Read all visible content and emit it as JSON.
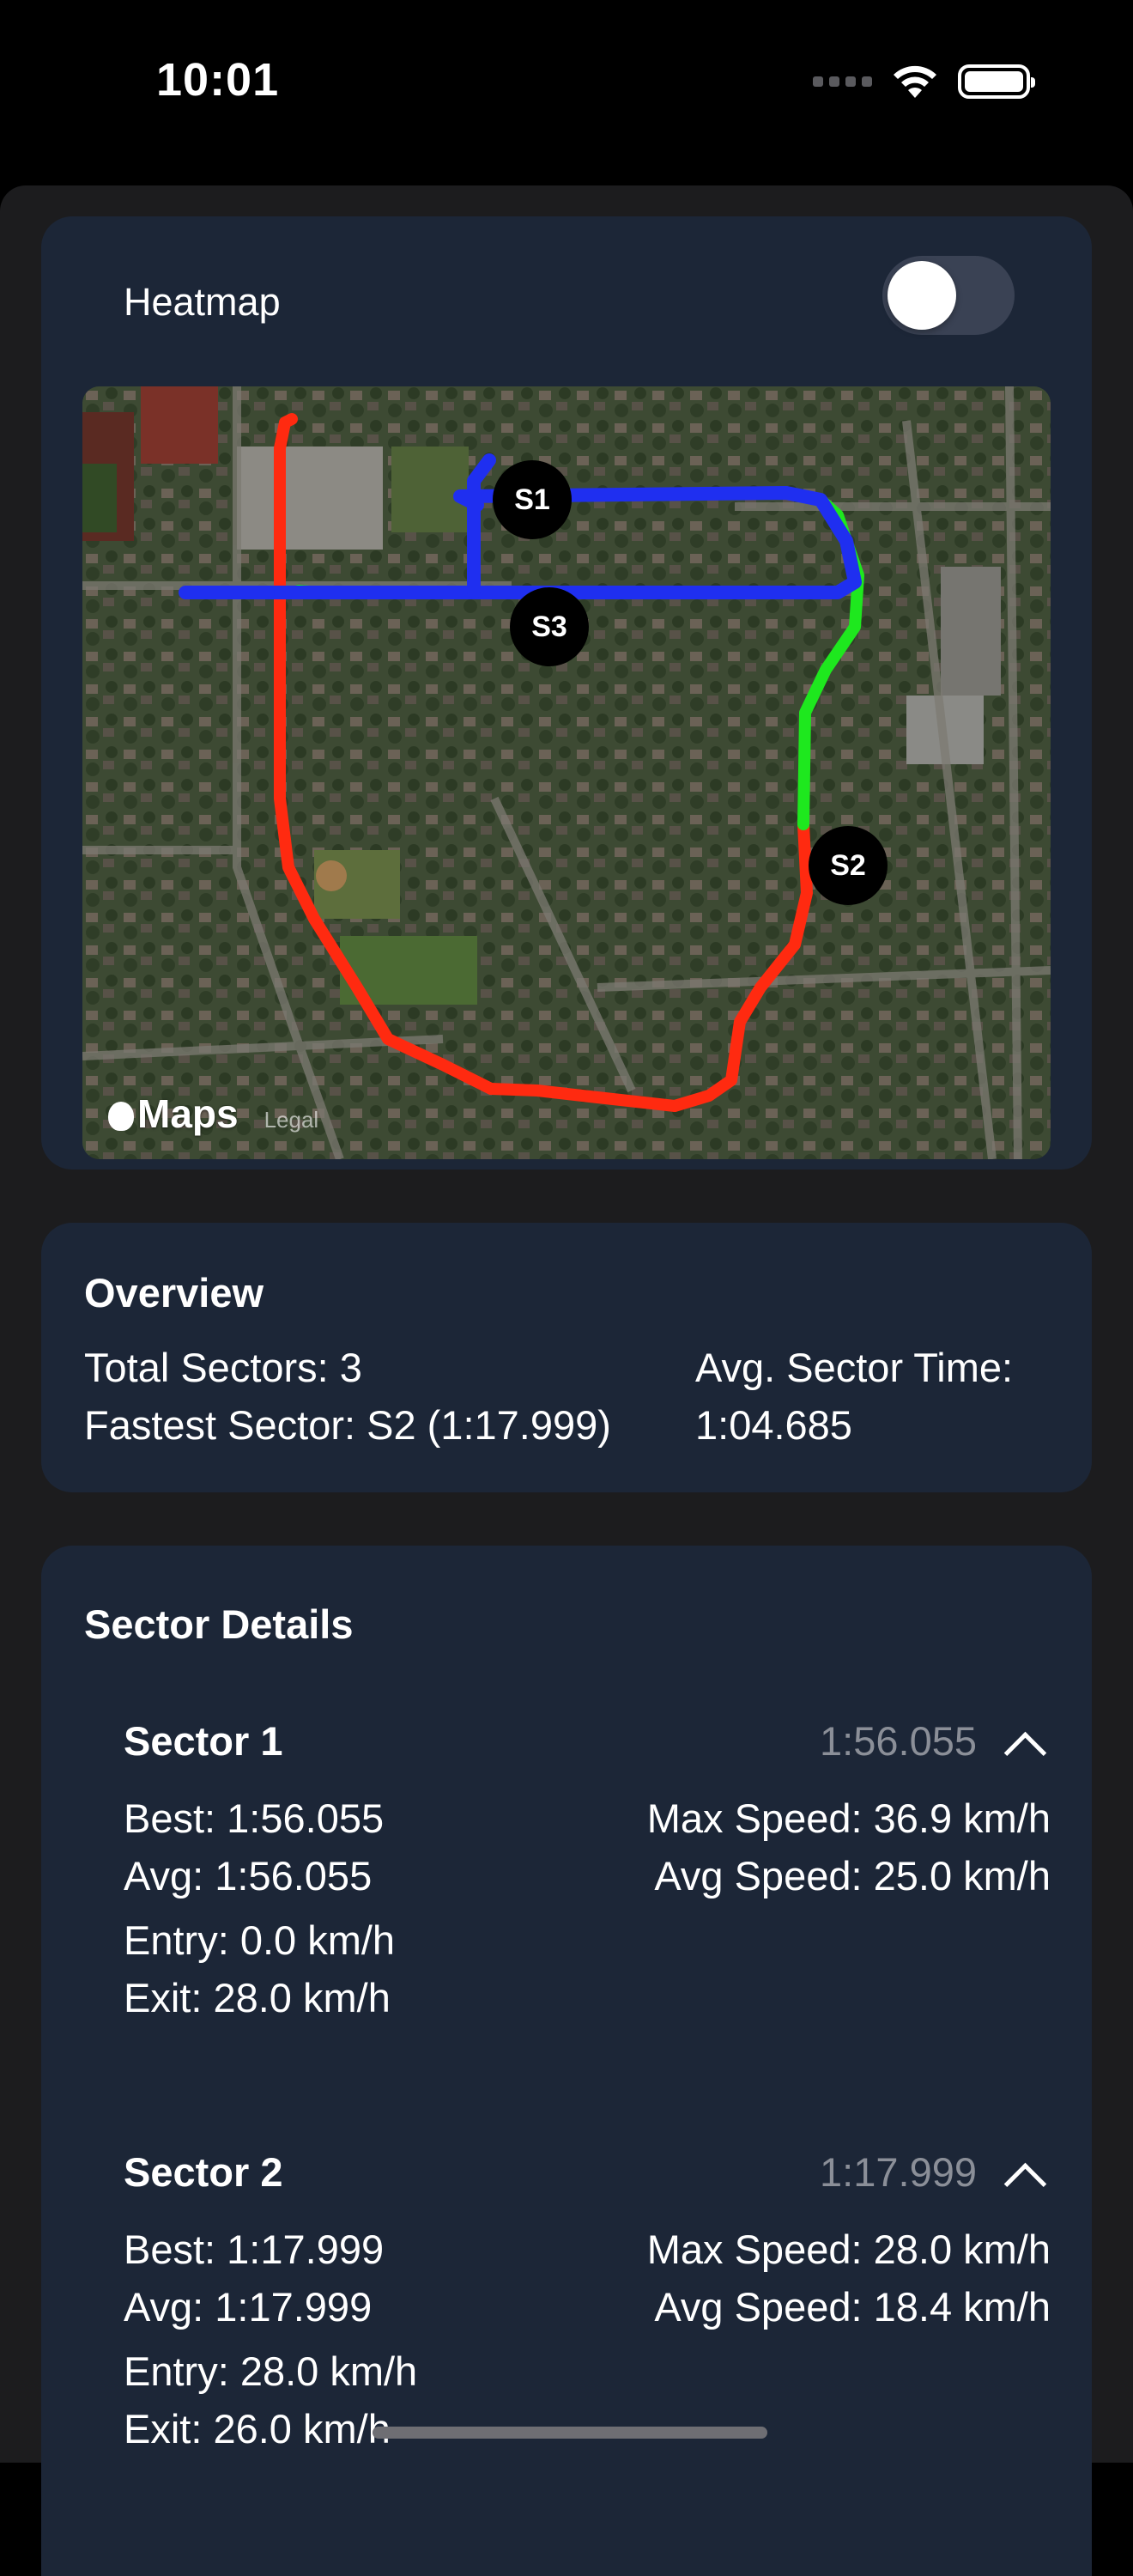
{
  "status_bar": {
    "time": "10:01",
    "icons": [
      "signal-icon",
      "wifi-icon",
      "battery-icon"
    ]
  },
  "heatmap": {
    "label": "Heatmap",
    "toggle_on": false,
    "map": {
      "attribution": "Maps",
      "legal": "Legal",
      "markers": [
        "S1",
        "S2",
        "S3"
      ],
      "route_colors": {
        "s1": "#1f2ff0",
        "s2": "#1ee81e",
        "s3": "#ff2a10"
      }
    }
  },
  "overview": {
    "title": "Overview",
    "total_sectors": "Total Sectors: 3",
    "fastest_sector": "Fastest Sector: S2 (1:17.999)",
    "avg_label": "Avg. Sector Time:",
    "avg_value": "1:04.685"
  },
  "sector_details": {
    "title": "Sector Details",
    "sectors": [
      {
        "name": "Sector 1",
        "time": "1:56.055",
        "best": "Best: 1:56.055",
        "avg": "Avg: 1:56.055",
        "max_speed": "Max Speed: 36.9 km/h",
        "avg_speed": "Avg Speed: 25.0 km/h",
        "entry": "Entry: 0.0 km/h",
        "exit": "Exit: 28.0 km/h"
      },
      {
        "name": "Sector 2",
        "time": "1:17.999",
        "best": "Best: 1:17.999",
        "avg": "Avg: 1:17.999",
        "max_speed": "Max Speed: 28.0 km/h",
        "avg_speed": "Avg Speed: 18.4 km/h",
        "entry": "Entry: 28.0 km/h",
        "exit": "Exit: 26.0 km/h"
      }
    ]
  },
  "colors": {
    "background": "#1c1c1e",
    "card": "#1c2637",
    "muted_text": "#8b8f98"
  }
}
